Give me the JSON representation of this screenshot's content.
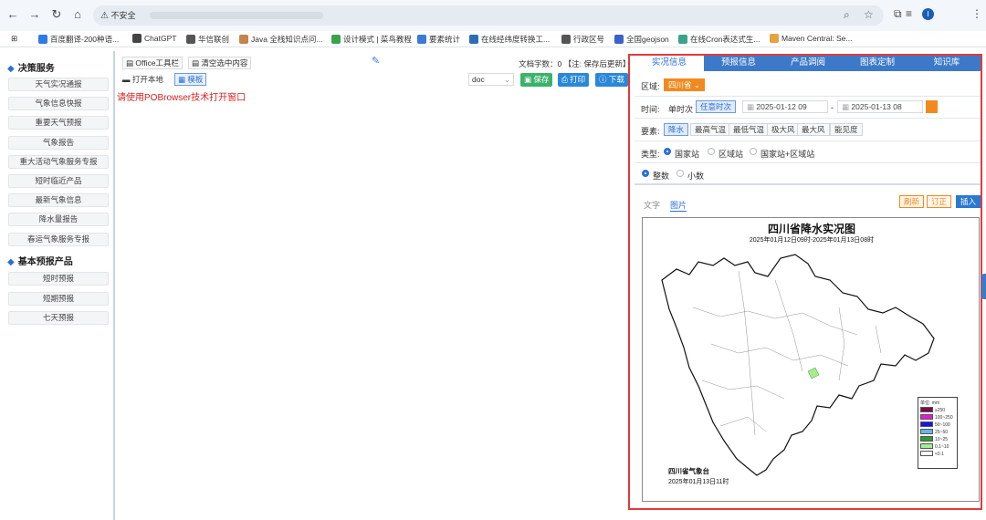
{
  "browser": {
    "security": "不安全",
    "url": ""
  },
  "bookmarks": [
    {
      "label": "百度翻译-200种语...",
      "color": "#2f7be5"
    },
    {
      "label": "ChatGPT",
      "color": "#444"
    },
    {
      "label": "华信联创",
      "color": "#555"
    },
    {
      "label": "Java 全栈知识点问...",
      "color": "#c4844a"
    },
    {
      "label": "设计模式 | 菜鸟教程",
      "color": "#3aa34a"
    },
    {
      "label": "要素统计",
      "color": "#3a7bd5"
    },
    {
      "label": "在线经纬度转换工...",
      "color": "#2c6db3"
    },
    {
      "label": "行政区号",
      "color": "#555"
    },
    {
      "label": "全国geojson",
      "color": "#3b62c9"
    },
    {
      "label": "在线Cron表达式生...",
      "color": "#3aa38a"
    },
    {
      "label": "Maven Central: Se...",
      "color": "#e6a23c"
    }
  ],
  "sidebar": {
    "group1": "决策服务",
    "items1": [
      "天气实况通报",
      "气象信息快报",
      "重要天气预报",
      "气象报告",
      "重大活动气象服务专报",
      "短时临近产品",
      "最新气象信息",
      "降水量报告",
      "春运气象服务专报"
    ],
    "group2": "基本预报产品",
    "items2": [
      "短时预报",
      "短期预报",
      "七天预报"
    ]
  },
  "editor": {
    "office_toolbar": "Office工具栏",
    "clear_selection": "清空选中内容",
    "open_local": "打开本地",
    "template": "模板",
    "doc_count_label": "文档字数：",
    "doc_count": "0",
    "doc_note": "【注: 保存后更新】",
    "format": "doc",
    "save": "保存",
    "print": "打印",
    "download": "下载",
    "notice": "请使用POBrowser技术打开窗口"
  },
  "panel": {
    "tabs": [
      "实况信息",
      "预报信息",
      "产品调阅",
      "图表定制",
      "知识库"
    ],
    "region_label": "区域:",
    "region_value": "四川省",
    "time_label": "时间:",
    "time_opts": [
      "单时次",
      "任意时次"
    ],
    "date_from": "2025-01-12 09",
    "date_sep": "-",
    "date_to": "2025-01-13 08",
    "element_label": "要素:",
    "elements": [
      "降水",
      "最高气温",
      "最低气温",
      "极大风",
      "最大风",
      "能见度"
    ],
    "type_label": "类型:",
    "types": [
      "国家站",
      "区域站",
      "国家站+区域站"
    ],
    "number_opts": [
      "整数",
      "小数"
    ],
    "view_tabs": [
      "文字",
      "图片"
    ],
    "refresh": "刷新",
    "correct": "订正",
    "insert": "插入"
  },
  "map": {
    "title": "四川省降水实况图",
    "subtitle": "2025年01月12日09时-2025年01月13日08时",
    "org": "四川省气象台",
    "issued": "2025年01月13日11时",
    "legend_title": "单位: mm",
    "legend": [
      {
        "label": "≥250",
        "color": "#7a0a4b"
      },
      {
        "label": "100~250",
        "color": "#e21ad9"
      },
      {
        "label": "50~100",
        "color": "#1515e0"
      },
      {
        "label": "25~50",
        "color": "#62b6ee"
      },
      {
        "label": "10~25",
        "color": "#2f9a2f"
      },
      {
        "label": "0.1~10",
        "color": "#a8ec90"
      },
      {
        "label": "<0.1",
        "color": "#ffffff"
      }
    ]
  }
}
